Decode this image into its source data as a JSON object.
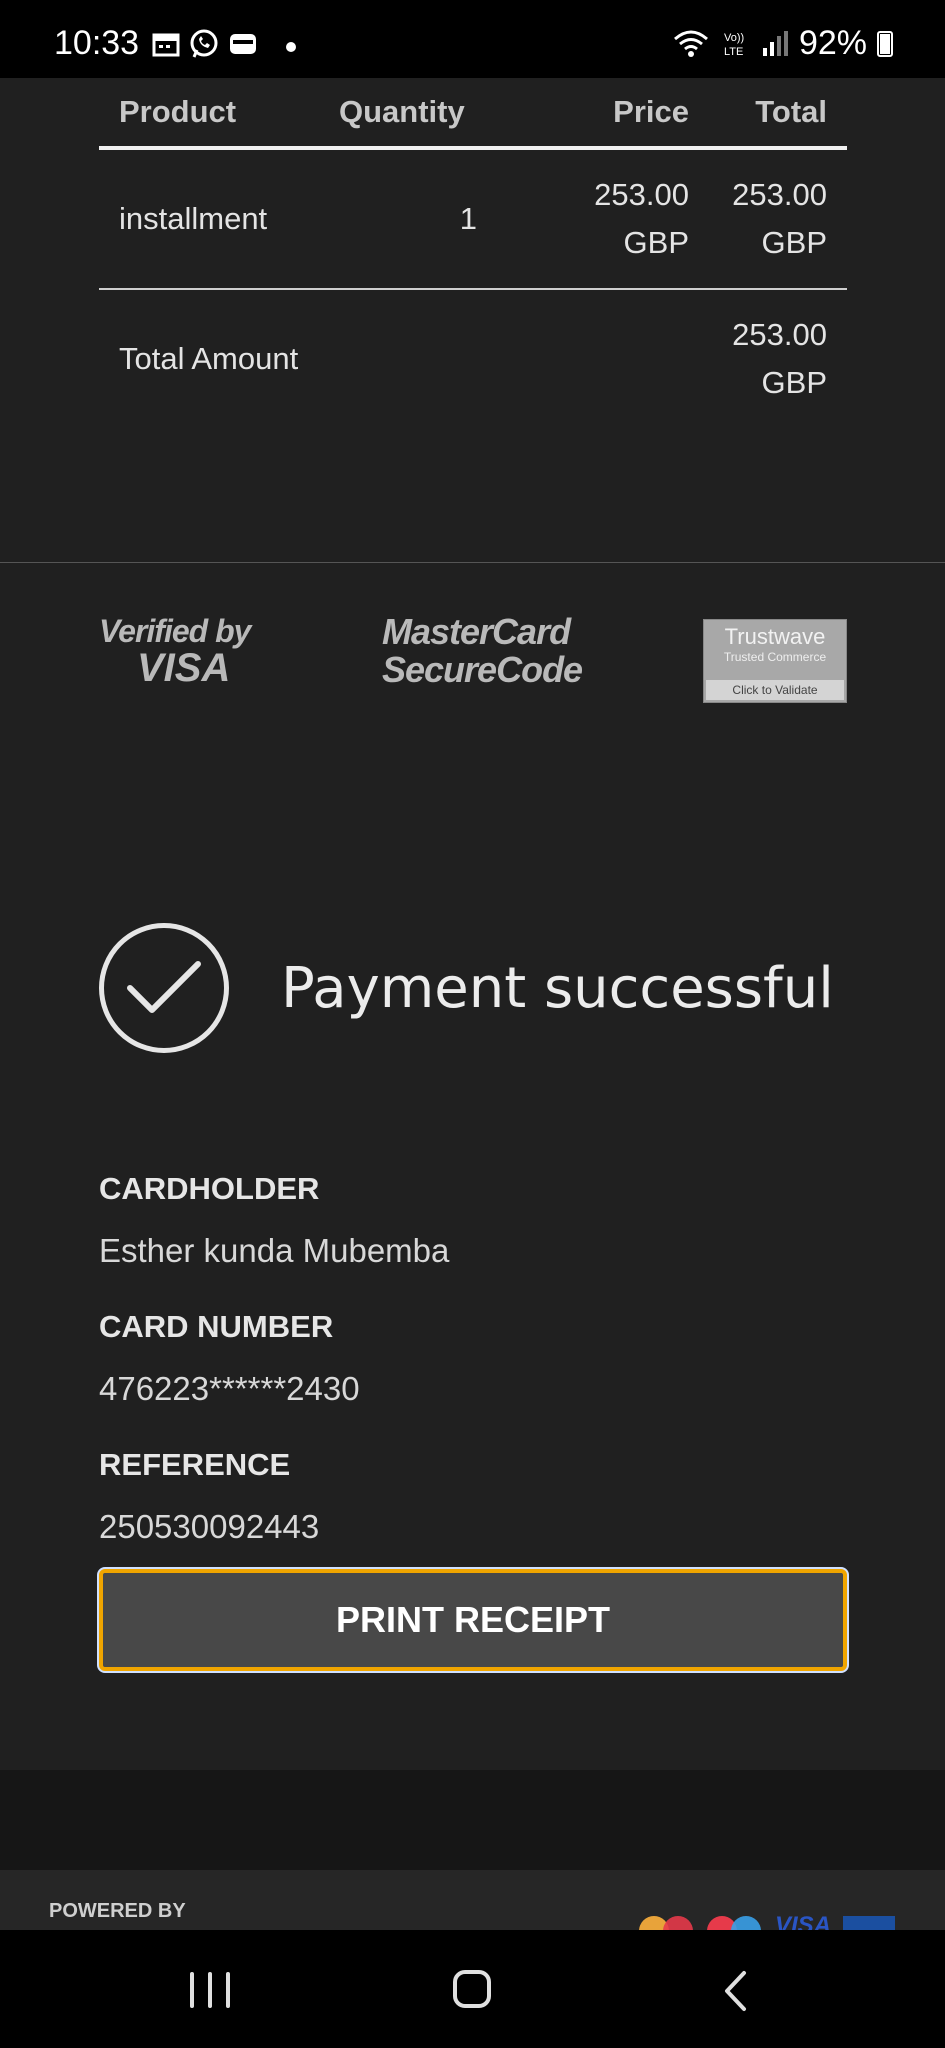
{
  "status_bar": {
    "time": "10:33",
    "battery": "92%"
  },
  "order_table": {
    "headers": {
      "product": "Product",
      "quantity": "Quantity",
      "price": "Price",
      "total": "Total"
    },
    "item": {
      "product": "installment",
      "quantity": "1",
      "price_amount": "253.00",
      "price_currency": "GBP",
      "total_amount": "253.00",
      "total_currency": "GBP"
    },
    "total_row": {
      "label": "Total Amount",
      "amount": "253.00",
      "currency": "GBP"
    }
  },
  "security_logos": {
    "verified_by": "Verified by",
    "visa": "VISA",
    "mastercard_line1": "MasterCard",
    "mastercard_line2": "SecureCode",
    "trustwave": "Trustwave",
    "trustwave_sub": "Trusted Commerce",
    "trustwave_validate": "Click to Validate"
  },
  "payment_status": {
    "message": "Payment successful"
  },
  "details": {
    "cardholder_label": "CARDHOLDER",
    "cardholder_value": "Esther kunda Mubemba",
    "card_number_label": "CARD NUMBER",
    "card_number_value": "476223******2430",
    "reference_label": "REFERENCE",
    "reference_value": "250530092443"
  },
  "print_button": {
    "label": "PRINT RECEIPT"
  },
  "footer": {
    "powered_by": "POWERED BY",
    "visa_small": "VISA"
  },
  "colors": {
    "background": "#202020",
    "button_border": "#f0a500",
    "button_bg": "#484848"
  }
}
